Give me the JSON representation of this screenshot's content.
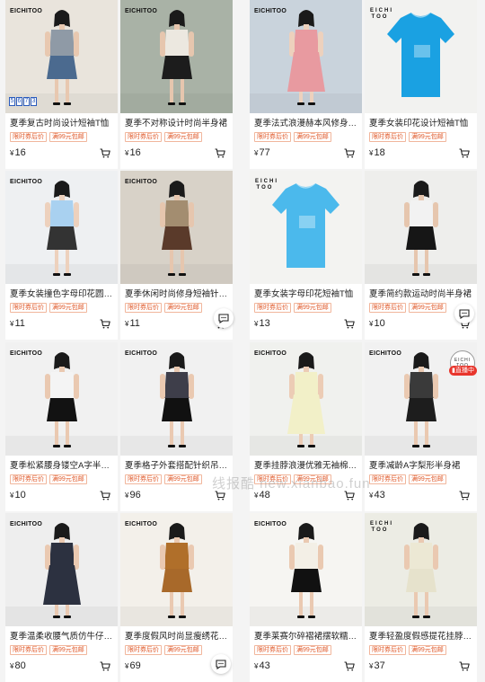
{
  "tag_coupon": "限时券后价",
  "tag_freeship": "满99元包邮",
  "currency": "¥",
  "watermark": "线报酷 new.xianbao.fun",
  "live": {
    "brand_top": "EICHI",
    "brand_bottom": "TOO",
    "label": "直播中"
  },
  "products": [
    {
      "brand": "EICHITOO",
      "title": "夏季复古时尚设计短袖T恤",
      "price": "16",
      "bg": "#e9e4dc",
      "figure": {
        "top": "#8f9aa6",
        "bottom": "#4b6a8f",
        "skin": "#e8c8b0"
      },
      "extra": "5673"
    },
    {
      "brand": "EICHITOO",
      "title": "夏季不对称设计时尚半身裙",
      "price": "16",
      "bg": "#a9b2a6",
      "figure": {
        "top": "#ece8e0",
        "bottom": "#1c1c1c",
        "skin": "#e6c6ae"
      }
    },
    {
      "brand": "EICHITOO",
      "title": "夏季法式浪漫赫本风修身连衣裙",
      "price": "77",
      "bg": "#c9d3dc",
      "figure": {
        "top": "#e89aa0",
        "bottom": "#e89aa0",
        "skin": "#edd1bd"
      }
    },
    {
      "brand": "EICHI TOO",
      "title": "夏季女装印花设计短袖T恤",
      "price": "18",
      "bg": "#f2f2f0",
      "figure": {
        "top": "#1aa1e2",
        "bottom": "#1aa1e2",
        "skin": "none"
      }
    },
    {
      "brand": "EICHITOO",
      "title": "夏季女装撞色字母印花圆领T恤",
      "price": "11",
      "bg": "#eef0f2",
      "figure": {
        "top": "#a9d1f0",
        "bottom": "#333333",
        "skin": "#edd1bd"
      }
    },
    {
      "brand": "EICHITOO",
      "title": "夏季休闲时尚修身短袖针织衫",
      "price": "11",
      "bg": "#d8d2c8",
      "figure": {
        "top": "#a38d70",
        "bottom": "#5a3a2a",
        "skin": "#e6c6ae"
      }
    },
    {
      "brand": "EICHI TOO",
      "title": "夏季女装字母印花短袖T恤",
      "price": "13",
      "bg": "#f3f3f1",
      "figure": {
        "top": "#4bb9ec",
        "bottom": "#4bb9ec",
        "skin": "none"
      }
    },
    {
      "brand": "",
      "title": "夏季简约款运动时尚半身裙",
      "price": "10",
      "bg": "#eeeeec",
      "figure": {
        "top": "#f2f2f2",
        "bottom": "#161616",
        "skin": "#e6c6ae"
      }
    },
    {
      "brand": "EICHITOO",
      "title": "夏季松紧腰身镂空A字半身裙",
      "price": "10",
      "bg": "#f1f1f1",
      "figure": {
        "top": "#f4f4f4",
        "bottom": "#121212",
        "skin": "#eac9b1"
      }
    },
    {
      "brand": "EICHITOO",
      "title": "夏季格子外套搭配针织吊带两件套",
      "price": "96",
      "bg": "#f1f1f1",
      "figure": {
        "top": "#3e3e4a",
        "bottom": "#111111",
        "skin": "#eac9b1"
      }
    },
    {
      "brand": "EICHITOO",
      "title": "夏季挂脖浪漫优雅无袖棉麻连衣裙",
      "price": "48",
      "bg": "#f0f1ee",
      "figure": {
        "top": "#f2f0c8",
        "bottom": "#f2f0c8",
        "skin": "#ecccb5"
      }
    },
    {
      "brand": "EICHITOO",
      "title": "夏季减龄A字梨形半身裙",
      "price": "43",
      "bg": "#f1f1f1",
      "figure": {
        "top": "#3a3a3a",
        "bottom": "#1d1d1d",
        "skin": "#eac9b1"
      },
      "live": true
    },
    {
      "brand": "EICHITOO",
      "title": "夏季温柔收腰气质仿牛仔连衣裙",
      "price": "80",
      "bg": "#eeeeee",
      "figure": {
        "top": "#2c3140",
        "bottom": "#2c3140",
        "skin": "#eac9b1"
      }
    },
    {
      "brand": "EICHITOO",
      "title": "夏季度假风时尚显瘦绣花两件套",
      "price": "69",
      "bg": "#f3f0ea",
      "figure": {
        "top": "#b06f2a",
        "bottom": "#a8692a",
        "skin": "#eac9b1"
      }
    },
    {
      "brand": "EICHITOO",
      "title": "夏季莱赛尔碎褶裙摆软糯半身裙",
      "price": "43",
      "bg": "#f6f5f2",
      "figure": {
        "top": "#f3efe6",
        "bottom": "#111111",
        "skin": "#eac9b1"
      }
    },
    {
      "brand": "EICHI TOO",
      "title": "夏季轻盈度假感提花挂脖两件套",
      "price": "37",
      "bg": "#ecece4",
      "figure": {
        "top": "#ece8d4",
        "bottom": "#e6e2cc",
        "skin": "#eac9b1"
      }
    }
  ]
}
